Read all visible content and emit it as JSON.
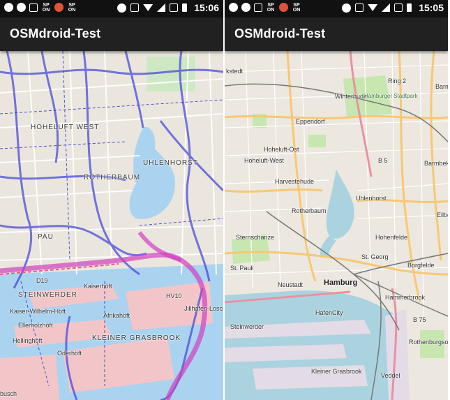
{
  "screens": [
    {
      "status": {
        "time": "15:06",
        "sp1": "SP ON",
        "sp2": "SP ON"
      },
      "app_title": "OSMdroid-Test",
      "map_labels": [
        "HOHELUFT WEST",
        "UHLENHORST",
        "ROTHERBAUM",
        "PAU",
        "STEINWERDER",
        "Kaiserhöft",
        "Kaiser-Wilhelm-Höft",
        "Ellerholzhöft",
        "Afrikahöft",
        "Hellinghöft",
        "Oderhöft",
        "KLEINER GRASBROOK",
        "Jillhafen-Loschpl",
        "HV10",
        "D19",
        "busch"
      ]
    },
    {
      "status": {
        "time": "15:05",
        "sp1": "SP ON",
        "sp2": "SP ON"
      },
      "app_title": "OSMdroid-Test",
      "map_labels": [
        "kstedt",
        "Ring 2",
        "Barm",
        "Winterhude",
        "Hamburger Stadtpark",
        "Eppendorf",
        "Hoheluft-Ost",
        "Hoheluft-West",
        "Harvestehude",
        "Barmbek-S",
        "Uhlenhorst",
        "Rotherbaum",
        "B 5",
        "Sternschanze",
        "Hohenfelde",
        "Eilbe",
        "St. Pauli",
        "St. Georg",
        "Borgfelde",
        "Neustadt",
        "Hamburg",
        "HafenCity",
        "Hammerbrook",
        "Steinwerder",
        "B 75",
        "Rothenburgsort",
        "Kleiner Grasbrook",
        "Veddel"
      ]
    }
  ]
}
